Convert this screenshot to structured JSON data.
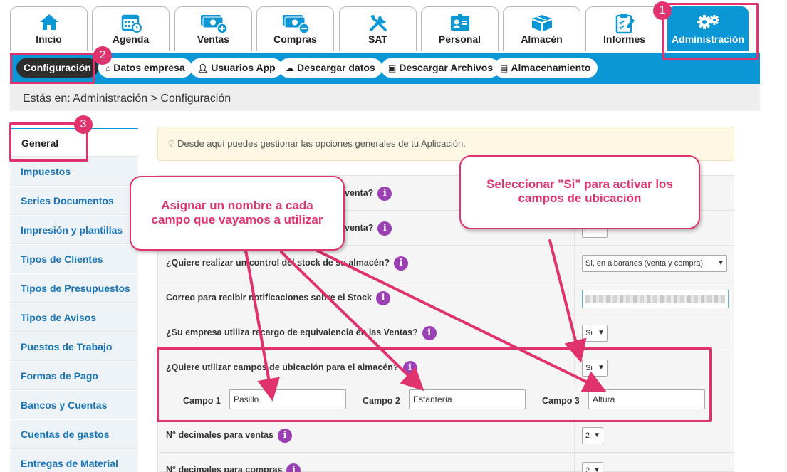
{
  "tabs": [
    {
      "label": "Inicio",
      "icon": "home-icon"
    },
    {
      "label": "Agenda",
      "icon": "calendar-icon"
    },
    {
      "label": "Ventas",
      "icon": "money-plus-icon"
    },
    {
      "label": "Compras",
      "icon": "money-minus-icon"
    },
    {
      "label": "SAT",
      "icon": "tools-icon"
    },
    {
      "label": "Personal",
      "icon": "id-card-icon"
    },
    {
      "label": "Almacén",
      "icon": "boxes-icon"
    },
    {
      "label": "Informes",
      "icon": "clipboard-icon"
    },
    {
      "label": "Administración",
      "icon": "gears-icon",
      "active": true
    }
  ],
  "subnav": {
    "configuracion": "Configuración",
    "datos_empresa": "Datos empresa",
    "usuarios_app": "Usuarios App",
    "descargar_datos": "Descargar datos",
    "descargar_archivos": "Descargar Archivos",
    "almacenamiento": "Almacenamiento"
  },
  "breadcrumb": "Estás en: Administración > Configuración",
  "sidebar": {
    "items": [
      "General",
      "Impuestos",
      "Series Documentos",
      "Impresión y plantillas",
      "Tipos de Clientes",
      "Tipos de Presupuestos",
      "Tipos de Avisos",
      "Puestos de Trabajo",
      "Formas de Pago",
      "Bancos y Cuentas",
      "Cuentas de gastos",
      "Entregas de Material"
    ]
  },
  "notice": "Desde aquí puedes gestionar las opciones generales de tu Aplicación.",
  "form": {
    "row1_question": "venta?",
    "row2_question": "venta?",
    "stock_question": "¿Quiere realizar un control del stock de su almacén?",
    "stock_value": "Si, en albaranes (venta y compra)",
    "email_question": "Correo para recibir notificaciones sobre el Stock",
    "recargo_question": "¿Su empresa utiliza recargo de equivalencia en las Ventas?",
    "recargo_value": "Si",
    "ubicacion_question": "¿Quiere utilizar campos de ubicación para el almacén?",
    "ubicacion_value": "Si",
    "campo1_label": "Campo 1",
    "campo1_value": "Pasillo",
    "campo2_label": "Campo 2",
    "campo2_value": "Estantería",
    "campo3_label": "Campo 3",
    "campo3_value": "Altura",
    "dec_ventas_question": "N° decimales para ventas",
    "dec_ventas_value": "2",
    "dec_compras_question": "N° decimales para compras",
    "dec_compras_value": "2",
    "info_glyph": "i"
  },
  "annotations": {
    "badge1": "1",
    "badge2": "2",
    "badge3": "3",
    "callout_left_line1": "Asignar un nombre a cada",
    "callout_left_line2": "campo que vayamos a utilizar",
    "callout_right_line1": "Seleccionar \"Si\" para activar los",
    "callout_right_line2": "campos de ubicación",
    "color": "#e0336d"
  },
  "colors": {
    "brand_blue": "#0b96d6",
    "link_blue": "#1a75b8",
    "info_purple": "#9b3fb5",
    "notice_bg": "#fcf8e3"
  }
}
